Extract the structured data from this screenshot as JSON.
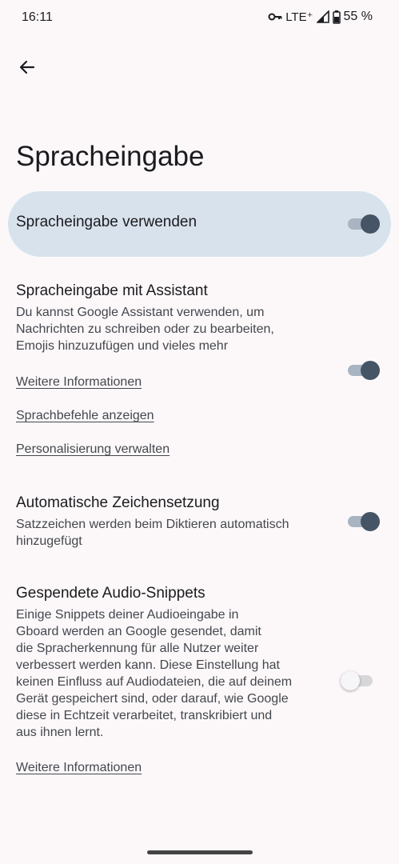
{
  "status_bar": {
    "time": "16:11",
    "network": "LTE⁺",
    "battery": "55 %"
  },
  "header": {
    "back_icon": "arrow-left-icon",
    "title": "Spracheingabe"
  },
  "master": {
    "label": "Spracheingabe verwenden",
    "enabled": true
  },
  "sections": [
    {
      "title": "Spracheingabe mit Assistant",
      "desc_lines": [
        "Du kannst Google Assistant verwenden, um",
        "Nachrichten zu schreiben oder zu bearbeiten,",
        "Emojis hinzuzufügen und vieles mehr"
      ],
      "enabled": true,
      "links": [
        "Weitere Informationen",
        "Sprachbefehle anzeigen",
        "Personalisierung verwalten"
      ]
    },
    {
      "title": "Automatische Zeichensetzung",
      "desc_lines": [
        "Satzzeichen werden beim Diktieren automatisch",
        "hinzugefügt"
      ],
      "enabled": true
    },
    {
      "title": "Gespendete Audio-Snippets",
      "desc_lines": [
        "Einige Snippets deiner Audioeingabe in",
        "Gboard werden an Google gesendet, damit",
        "die Spracherkennung für alle Nutzer weiter",
        "verbessert werden kann. Diese Einstellung hat",
        "keinen Einfluss auf Audiodateien, die auf deinem",
        "Gerät gespeichert sind, oder darauf, wie Google",
        "diese in Echtzeit verarbeitet, transkribiert und",
        "aus ihnen lernt."
      ],
      "enabled": false,
      "links": [
        "Weitere Informationen"
      ]
    }
  ],
  "colors": {
    "background": "#fcf8f9",
    "card": "#d8e2ec",
    "switch_thumb_on": "#455565",
    "switch_track_on": "#a8b4c2"
  }
}
